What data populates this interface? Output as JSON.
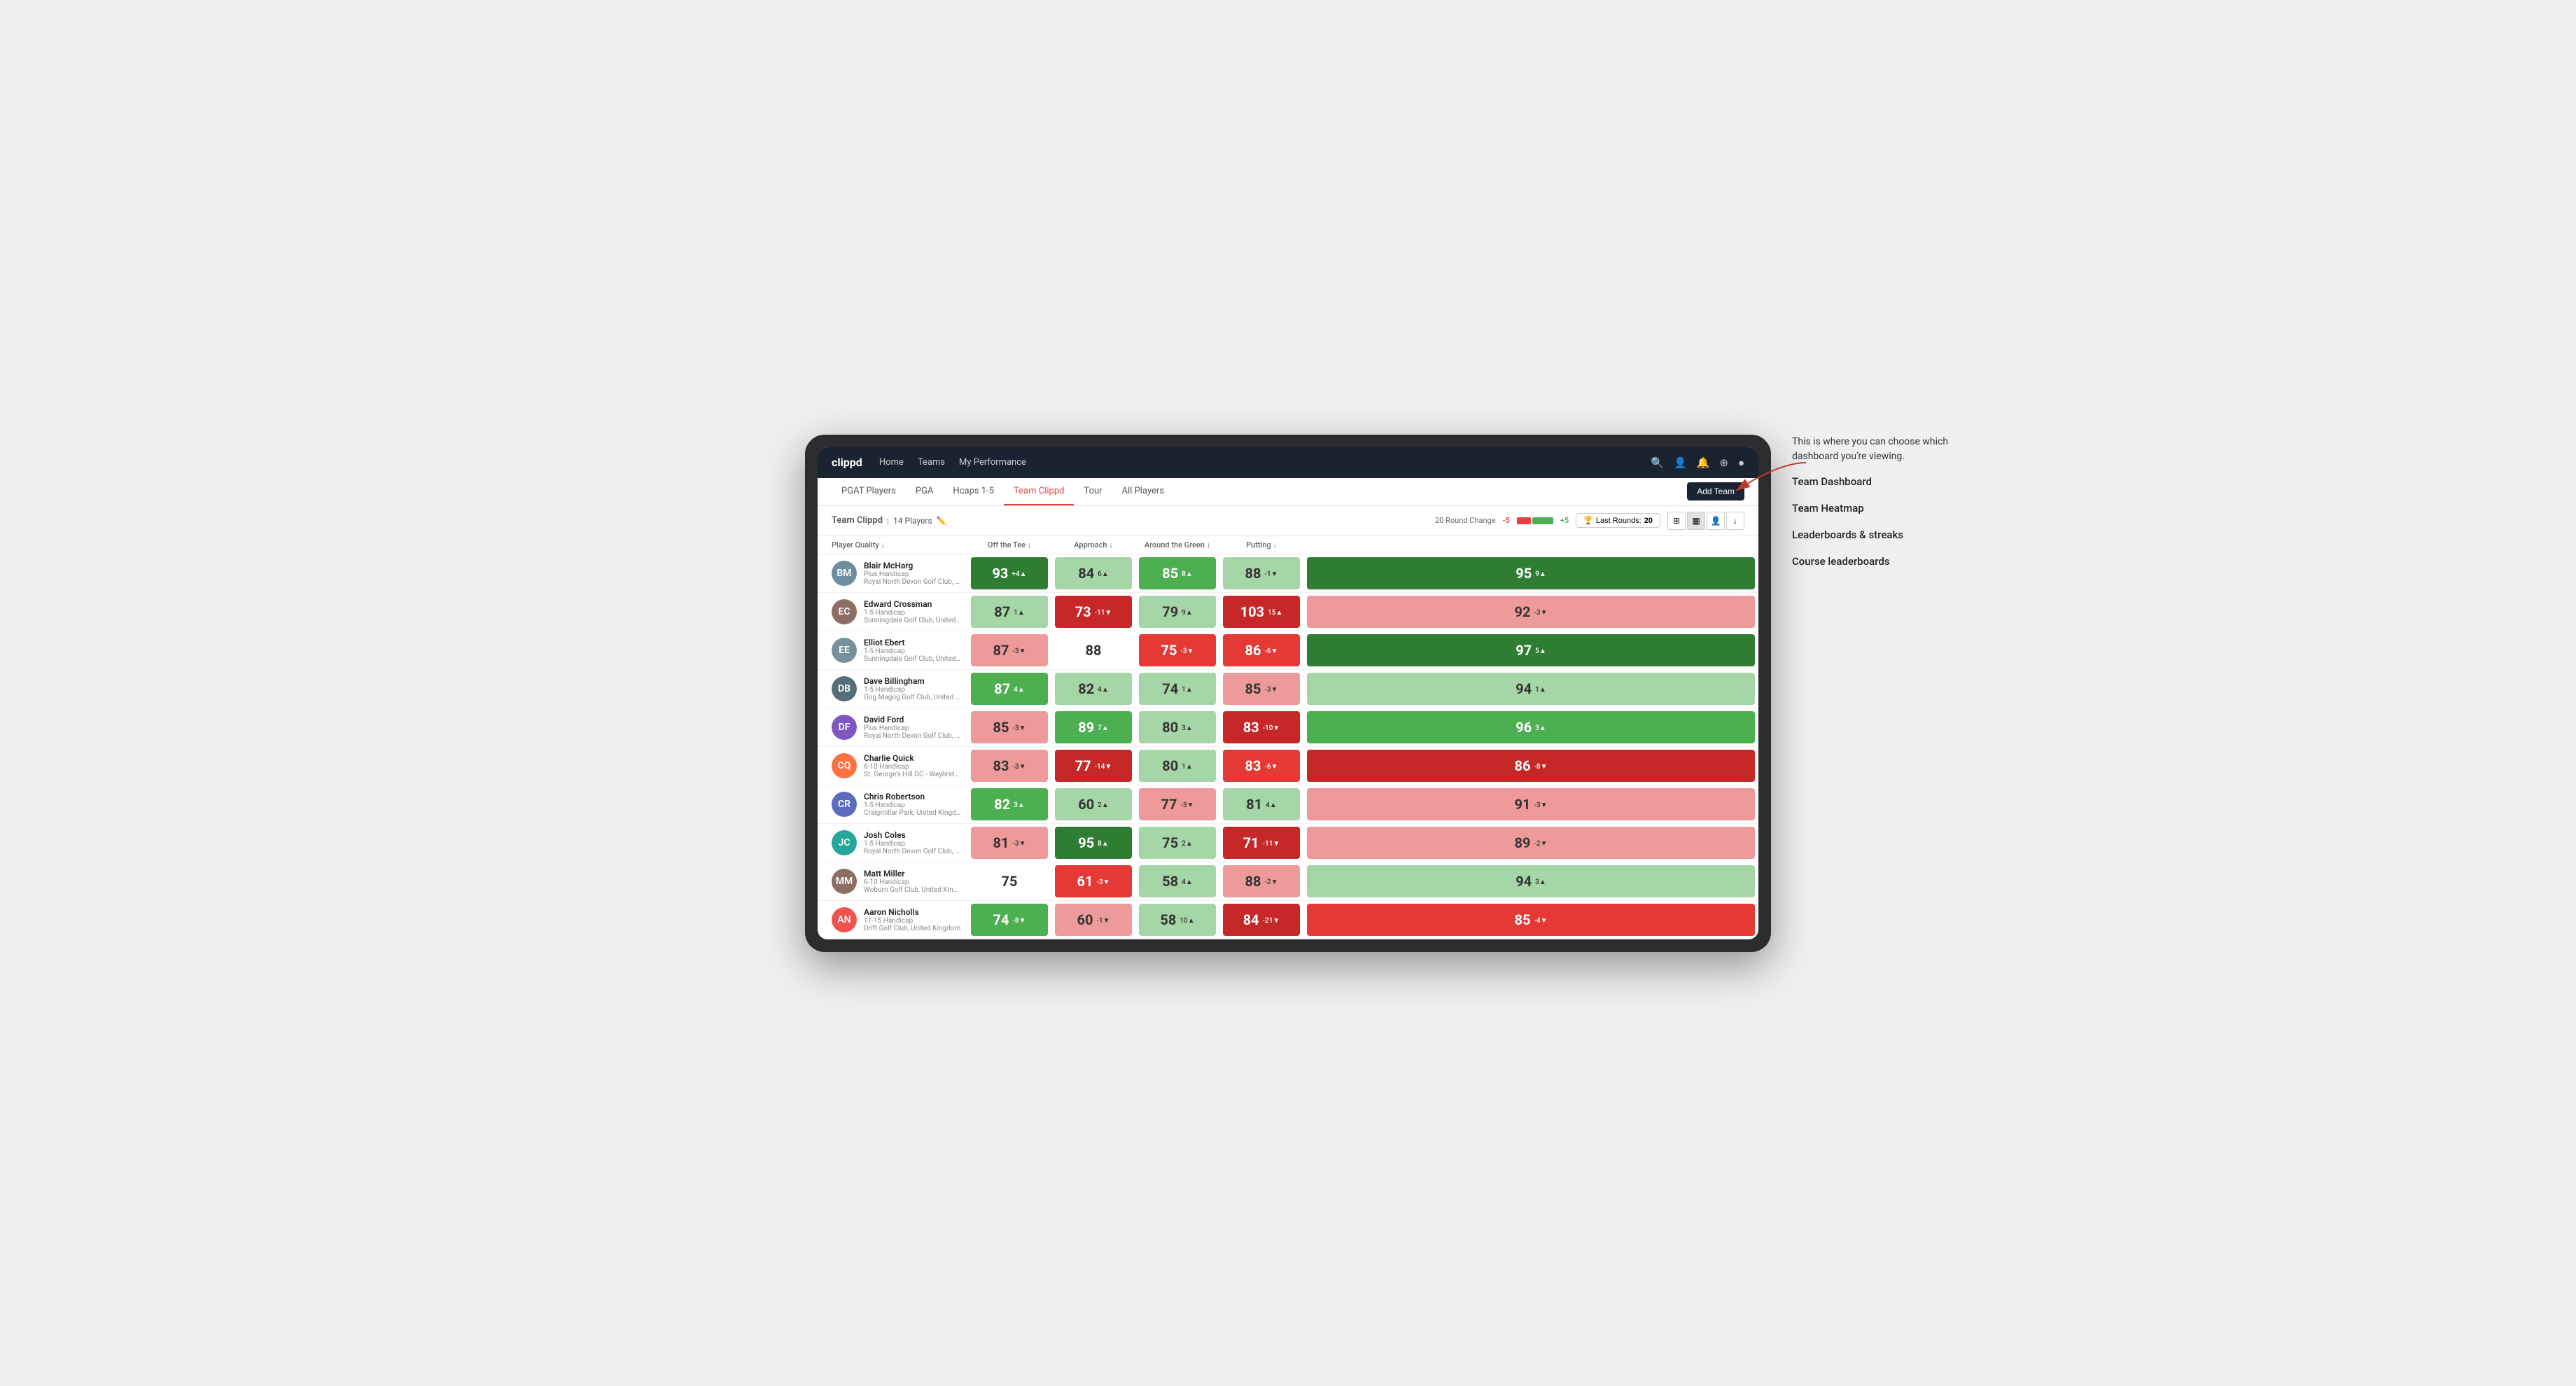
{
  "annotation": {
    "intro": "This is where you can choose which dashboard you're viewing.",
    "items": [
      "Team Dashboard",
      "Team Heatmap",
      "Leaderboards & streaks",
      "Course leaderboards"
    ]
  },
  "navbar": {
    "brand": "clippd",
    "links": [
      "Home",
      "Teams",
      "My Performance"
    ],
    "icons": [
      "search",
      "user",
      "bell",
      "circle-plus",
      "user-circle"
    ]
  },
  "subnav": {
    "links": [
      "PGAT Players",
      "PGA",
      "Hcaps 1-5",
      "Team Clippd",
      "Tour",
      "All Players"
    ],
    "active": "Team Clippd",
    "add_button": "Add Team"
  },
  "team_header": {
    "name": "Team Clippd",
    "count": "14 Players",
    "round_change_label": "20 Round Change",
    "neg_value": "-5",
    "pos_value": "+5",
    "last_rounds_label": "Last Rounds:",
    "last_rounds_value": "20"
  },
  "table": {
    "columns": [
      {
        "id": "player",
        "label": "Player Quality ↓"
      },
      {
        "id": "off_tee",
        "label": "Off the Tee ↓"
      },
      {
        "id": "approach",
        "label": "Approach ↓"
      },
      {
        "id": "around_green",
        "label": "Around the Green ↓"
      },
      {
        "id": "putting",
        "label": "Putting ↓"
      }
    ],
    "players": [
      {
        "name": "Blair McHarg",
        "handicap": "Plus Handicap",
        "club": "Royal North Devon Golf Club, United Kingdom",
        "initials": "BM",
        "avatar_color": "#6d8ea0",
        "scores": [
          {
            "value": 93,
            "delta": "+4",
            "dir": "up",
            "color": "green-dark"
          },
          {
            "value": 84,
            "delta": "6",
            "dir": "up",
            "color": "green-light"
          },
          {
            "value": 85,
            "delta": "8",
            "dir": "up",
            "color": "green-mid"
          },
          {
            "value": 88,
            "delta": "-1",
            "dir": "down",
            "color": "green-light"
          },
          {
            "value": 95,
            "delta": "9",
            "dir": "up",
            "color": "green-dark"
          }
        ]
      },
      {
        "name": "Edward Crossman",
        "handicap": "1-5 Handicap",
        "club": "Sunningdale Golf Club, United Kingdom",
        "initials": "EC",
        "avatar_color": "#8d6e63",
        "scores": [
          {
            "value": 87,
            "delta": "1",
            "dir": "up",
            "color": "green-light"
          },
          {
            "value": 73,
            "delta": "-11",
            "dir": "down",
            "color": "red-dark"
          },
          {
            "value": 79,
            "delta": "9",
            "dir": "up",
            "color": "green-light"
          },
          {
            "value": 103,
            "delta": "15",
            "dir": "up",
            "color": "red-dark"
          },
          {
            "value": 92,
            "delta": "-3",
            "dir": "down",
            "color": "red-light"
          }
        ]
      },
      {
        "name": "Elliot Ebert",
        "handicap": "1-5 Handicap",
        "club": "Sunningdale Golf Club, United Kingdom",
        "initials": "EE",
        "avatar_color": "#78909c",
        "scores": [
          {
            "value": 87,
            "delta": "-3",
            "dir": "down",
            "color": "red-light"
          },
          {
            "value": 88,
            "delta": "",
            "dir": "",
            "color": "white"
          },
          {
            "value": 75,
            "delta": "-3",
            "dir": "down",
            "color": "red-mid"
          },
          {
            "value": 86,
            "delta": "-6",
            "dir": "down",
            "color": "red-mid"
          },
          {
            "value": 97,
            "delta": "5",
            "dir": "up",
            "color": "green-dark"
          }
        ]
      },
      {
        "name": "Dave Billingham",
        "handicap": "1-5 Handicap",
        "club": "Gog Magog Golf Club, United Kingdom",
        "initials": "DB",
        "avatar_color": "#546e7a",
        "scores": [
          {
            "value": 87,
            "delta": "4",
            "dir": "up",
            "color": "green-mid"
          },
          {
            "value": 82,
            "delta": "4",
            "dir": "up",
            "color": "green-light"
          },
          {
            "value": 74,
            "delta": "1",
            "dir": "up",
            "color": "green-light"
          },
          {
            "value": 85,
            "delta": "-3",
            "dir": "down",
            "color": "red-light"
          },
          {
            "value": 94,
            "delta": "1",
            "dir": "up",
            "color": "green-light"
          }
        ]
      },
      {
        "name": "David Ford",
        "handicap": "Plus Handicap",
        "club": "Royal North Devon Golf Club, United Kingdom",
        "initials": "DF",
        "avatar_color": "#7e57c2",
        "scores": [
          {
            "value": 85,
            "delta": "-3",
            "dir": "down",
            "color": "red-light"
          },
          {
            "value": 89,
            "delta": "7",
            "dir": "up",
            "color": "green-mid"
          },
          {
            "value": 80,
            "delta": "3",
            "dir": "up",
            "color": "green-light"
          },
          {
            "value": 83,
            "delta": "-10",
            "dir": "down",
            "color": "red-dark"
          },
          {
            "value": 96,
            "delta": "3",
            "dir": "up",
            "color": "green-mid"
          }
        ]
      },
      {
        "name": "Charlie Quick",
        "handicap": "6-10 Handicap",
        "club": "St. George's Hill GC - Weybridge - Surrey, Uni...",
        "initials": "CQ",
        "avatar_color": "#ff7043",
        "scores": [
          {
            "value": 83,
            "delta": "-3",
            "dir": "down",
            "color": "red-light"
          },
          {
            "value": 77,
            "delta": "-14",
            "dir": "down",
            "color": "red-dark"
          },
          {
            "value": 80,
            "delta": "1",
            "dir": "up",
            "color": "green-light"
          },
          {
            "value": 83,
            "delta": "-6",
            "dir": "down",
            "color": "red-mid"
          },
          {
            "value": 86,
            "delta": "-8",
            "dir": "down",
            "color": "red-dark"
          }
        ]
      },
      {
        "name": "Chris Robertson",
        "handicap": "1-5 Handicap",
        "club": "Craigmillar Park, United Kingdom",
        "initials": "CR",
        "avatar_color": "#5c6bc0",
        "scores": [
          {
            "value": 82,
            "delta": "3",
            "dir": "up",
            "color": "green-mid"
          },
          {
            "value": 60,
            "delta": "2",
            "dir": "up",
            "color": "green-light"
          },
          {
            "value": 77,
            "delta": "-3",
            "dir": "down",
            "color": "red-light"
          },
          {
            "value": 81,
            "delta": "4",
            "dir": "up",
            "color": "green-light"
          },
          {
            "value": 91,
            "delta": "-3",
            "dir": "down",
            "color": "red-light"
          }
        ]
      },
      {
        "name": "Josh Coles",
        "handicap": "1-5 Handicap",
        "club": "Royal North Devon Golf Club, United Kingdom",
        "initials": "JC",
        "avatar_color": "#26a69a",
        "scores": [
          {
            "value": 81,
            "delta": "-3",
            "dir": "down",
            "color": "red-light"
          },
          {
            "value": 95,
            "delta": "8",
            "dir": "up",
            "color": "green-dark"
          },
          {
            "value": 75,
            "delta": "2",
            "dir": "up",
            "color": "green-light"
          },
          {
            "value": 71,
            "delta": "-11",
            "dir": "down",
            "color": "red-dark"
          },
          {
            "value": 89,
            "delta": "-2",
            "dir": "down",
            "color": "red-light"
          }
        ]
      },
      {
        "name": "Matt Miller",
        "handicap": "6-10 Handicap",
        "club": "Woburn Golf Club, United Kingdom",
        "initials": "MM",
        "avatar_color": "#8d6e63",
        "scores": [
          {
            "value": 75,
            "delta": "",
            "dir": "",
            "color": "white"
          },
          {
            "value": 61,
            "delta": "-3",
            "dir": "down",
            "color": "red-mid"
          },
          {
            "value": 58,
            "delta": "4",
            "dir": "up",
            "color": "green-light"
          },
          {
            "value": 88,
            "delta": "-2",
            "dir": "down",
            "color": "red-light"
          },
          {
            "value": 94,
            "delta": "3",
            "dir": "up",
            "color": "green-light"
          }
        ]
      },
      {
        "name": "Aaron Nicholls",
        "handicap": "11-15 Handicap",
        "club": "Drift Golf Club, United Kingdom",
        "initials": "AN",
        "avatar_color": "#ef5350",
        "scores": [
          {
            "value": 74,
            "delta": "-8",
            "dir": "down",
            "color": "green-mid"
          },
          {
            "value": 60,
            "delta": "-1",
            "dir": "down",
            "color": "red-light"
          },
          {
            "value": 58,
            "delta": "10",
            "dir": "up",
            "color": "green-light"
          },
          {
            "value": 84,
            "delta": "-21",
            "dir": "down",
            "color": "red-dark"
          },
          {
            "value": 85,
            "delta": "-4",
            "dir": "down",
            "color": "red-mid"
          }
        ]
      }
    ]
  },
  "colors": {
    "green_dark": "#2e7d32",
    "green_mid": "#4caf50",
    "green_light": "#a5d6a7",
    "red_dark": "#c62828",
    "red_mid": "#e53935",
    "red_light": "#ef9a9a",
    "white": "#ffffff",
    "navbar_bg": "#1a2332",
    "brand_red": "#e84040"
  }
}
